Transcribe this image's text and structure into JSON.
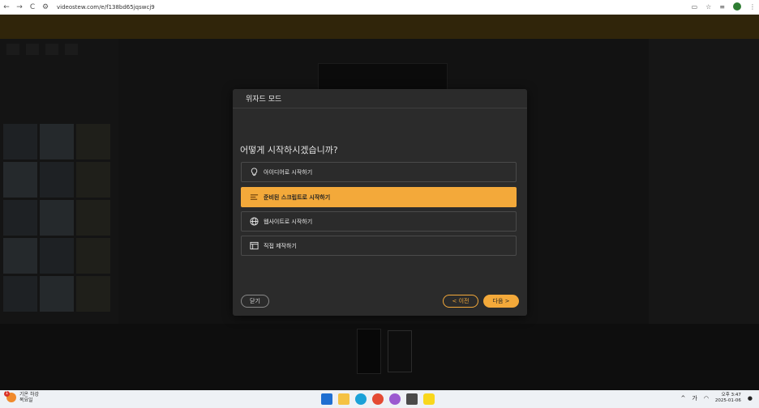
{
  "browser": {
    "url": "videostew.com/e/f138bd65jqswcj9",
    "back": "←",
    "forward": "→",
    "reload": "C"
  },
  "modal": {
    "title": "위자드 모드",
    "question": "어떻게 시작하시겠습니까?",
    "options": [
      {
        "label": "아이디어로 시작하기",
        "icon": "lightbulb-icon"
      },
      {
        "label": "준비된 스크립트로 시작하기",
        "icon": "script-icon",
        "selected": true
      },
      {
        "label": "웹사이트로 시작하기",
        "icon": "globe-icon"
      },
      {
        "label": "직접 제작하기",
        "icon": "layout-icon"
      }
    ],
    "close_label": "닫기",
    "prev_label": "< 이전",
    "next_label": "다음 >"
  },
  "taskbar": {
    "weather_temp": "기온 하강",
    "weather_day": "목요일",
    "notification_count": "1",
    "time": "오후 3:47",
    "date": "2025-01-06",
    "ime": "가"
  },
  "colors": {
    "accent": "#f3a93a",
    "modal_bg": "#2b2b2b"
  }
}
